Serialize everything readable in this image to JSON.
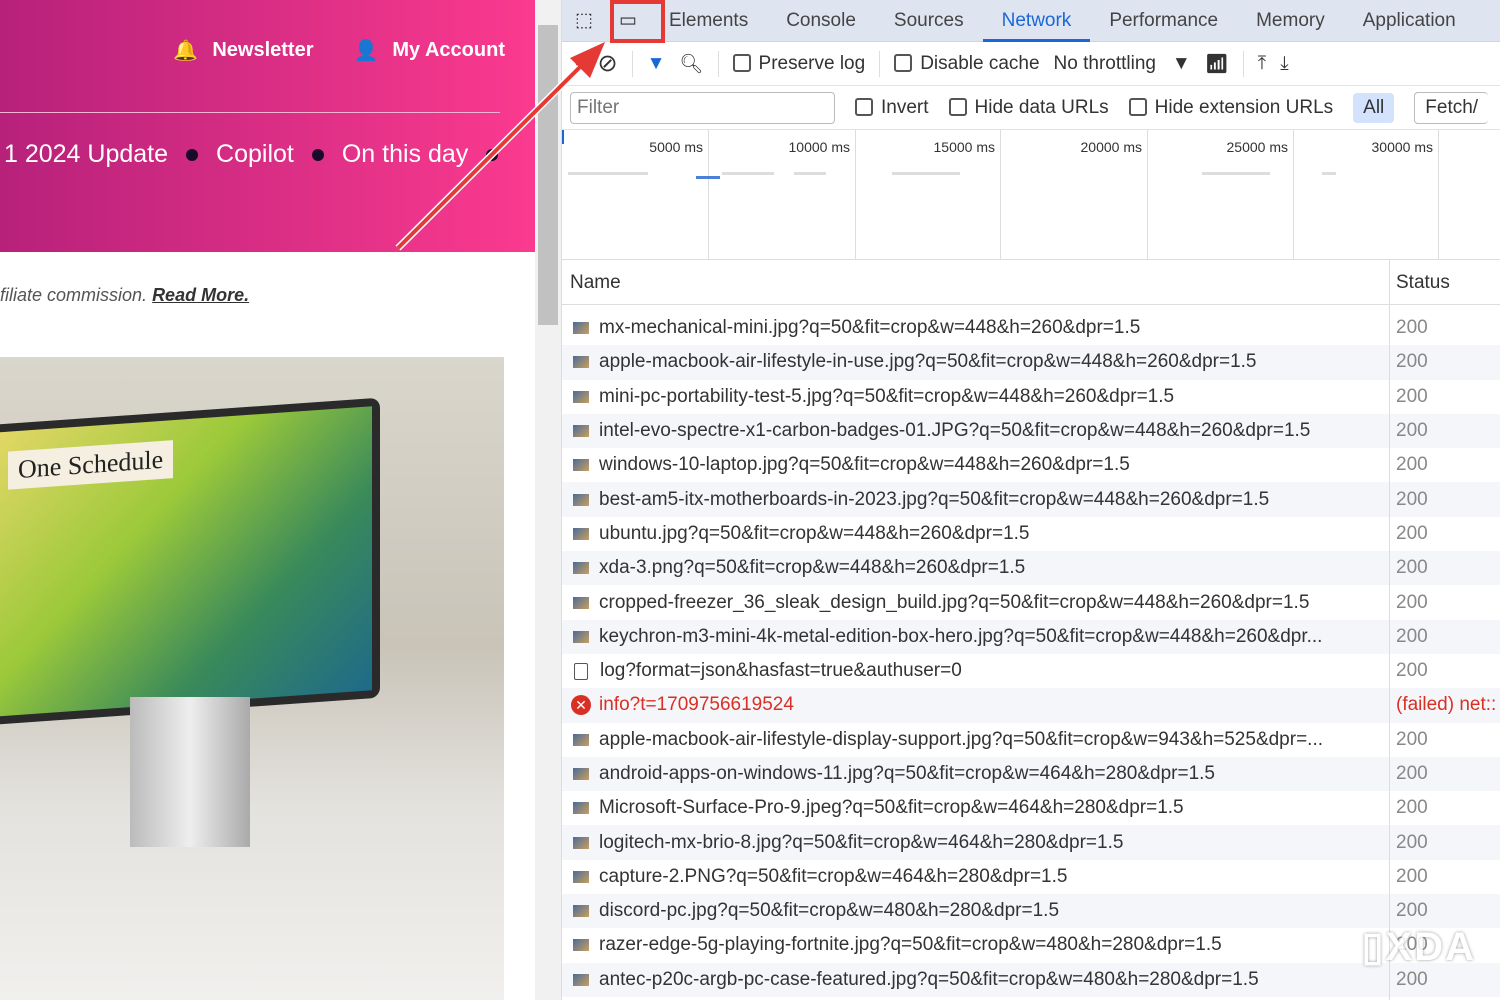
{
  "site": {
    "nav": [
      {
        "label": "Newsletter",
        "icon": "bell-icon"
      },
      {
        "label": "My Account",
        "icon": "user-check-icon"
      }
    ],
    "trending": [
      "1 2024 Update",
      "Copilot",
      "On this day"
    ],
    "affiliate_text": "filiate commission.",
    "read_more": "Read More.",
    "photo_text": "One Schedule",
    "colors": {
      "hero_start": "#b7217a",
      "hero_end": "#fb3a8f"
    }
  },
  "devtools": {
    "tabs": [
      "Elements",
      "Console",
      "Sources",
      "Network",
      "Performance",
      "Memory",
      "Application"
    ],
    "active_tab": "Network",
    "toolbar": {
      "preserve_log": "Preserve log",
      "disable_cache": "Disable cache",
      "throttling": "No throttling"
    },
    "filter": {
      "placeholder": "Filter",
      "invert": "Invert",
      "hide_data": "Hide data URLs",
      "hide_ext": "Hide extension URLs",
      "all": "All",
      "fetch": "Fetch/"
    },
    "timeline": [
      "5000 ms",
      "10000 ms",
      "15000 ms",
      "20000 ms",
      "25000 ms",
      "30000 ms"
    ],
    "columns": {
      "name": "Name",
      "status": "Status"
    },
    "rows": [
      {
        "name": "mx-mechanical-mini.jpg?q=50&fit=crop&w=448&h=260&dpr=1.5",
        "status": "200",
        "type": "img"
      },
      {
        "name": "apple-macbook-air-lifestyle-in-use.jpg?q=50&fit=crop&w=448&h=260&dpr=1.5",
        "status": "200",
        "type": "img"
      },
      {
        "name": "mini-pc-portability-test-5.jpg?q=50&fit=crop&w=448&h=260&dpr=1.5",
        "status": "200",
        "type": "img"
      },
      {
        "name": "intel-evo-spectre-x1-carbon-badges-01.JPG?q=50&fit=crop&w=448&h=260&dpr=1.5",
        "status": "200",
        "type": "img"
      },
      {
        "name": "windows-10-laptop.jpg?q=50&fit=crop&w=448&h=260&dpr=1.5",
        "status": "200",
        "type": "img"
      },
      {
        "name": "best-am5-itx-motherboards-in-2023.jpg?q=50&fit=crop&w=448&h=260&dpr=1.5",
        "status": "200",
        "type": "img"
      },
      {
        "name": "ubuntu.jpg?q=50&fit=crop&w=448&h=260&dpr=1.5",
        "status": "200",
        "type": "img"
      },
      {
        "name": "xda-3.png?q=50&fit=crop&w=448&h=260&dpr=1.5",
        "status": "200",
        "type": "img"
      },
      {
        "name": "cropped-freezer_36_sleak_design_build.jpg?q=50&fit=crop&w=448&h=260&dpr=1.5",
        "status": "200",
        "type": "img"
      },
      {
        "name": "keychron-m3-mini-4k-metal-edition-box-hero.jpg?q=50&fit=crop&w=448&h=260&dpr...",
        "status": "200",
        "type": "img"
      },
      {
        "name": "log?format=json&hasfast=true&authuser=0",
        "status": "200",
        "type": "doc"
      },
      {
        "name": "info?t=1709756619524",
        "status": "(failed) net::",
        "type": "error"
      },
      {
        "name": "apple-macbook-air-lifestyle-display-support.jpg?q=50&fit=crop&w=943&h=525&dpr=...",
        "status": "200",
        "type": "img"
      },
      {
        "name": "android-apps-on-windows-11.jpg?q=50&fit=crop&w=464&h=280&dpr=1.5",
        "status": "200",
        "type": "img"
      },
      {
        "name": "Microsoft-Surface-Pro-9.jpeg?q=50&fit=crop&w=464&h=280&dpr=1.5",
        "status": "200",
        "type": "img"
      },
      {
        "name": "logitech-mx-brio-8.jpg?q=50&fit=crop&w=464&h=280&dpr=1.5",
        "status": "200",
        "type": "img"
      },
      {
        "name": "capture-2.PNG?q=50&fit=crop&w=464&h=280&dpr=1.5",
        "status": "200",
        "type": "img"
      },
      {
        "name": "discord-pc.jpg?q=50&fit=crop&w=480&h=280&dpr=1.5",
        "status": "200",
        "type": "img"
      },
      {
        "name": "razer-edge-5g-playing-fortnite.jpg?q=50&fit=crop&w=480&h=280&dpr=1.5",
        "status": "200",
        "type": "img"
      },
      {
        "name": "antec-p20c-argb-pc-case-featured.jpg?q=50&fit=crop&w=480&h=280&dpr=1.5",
        "status": "200",
        "type": "img"
      }
    ],
    "colors": {
      "accent": "#1a68d6",
      "error": "#d93025",
      "highlight": "#e53935"
    }
  },
  "watermark": "XDA"
}
